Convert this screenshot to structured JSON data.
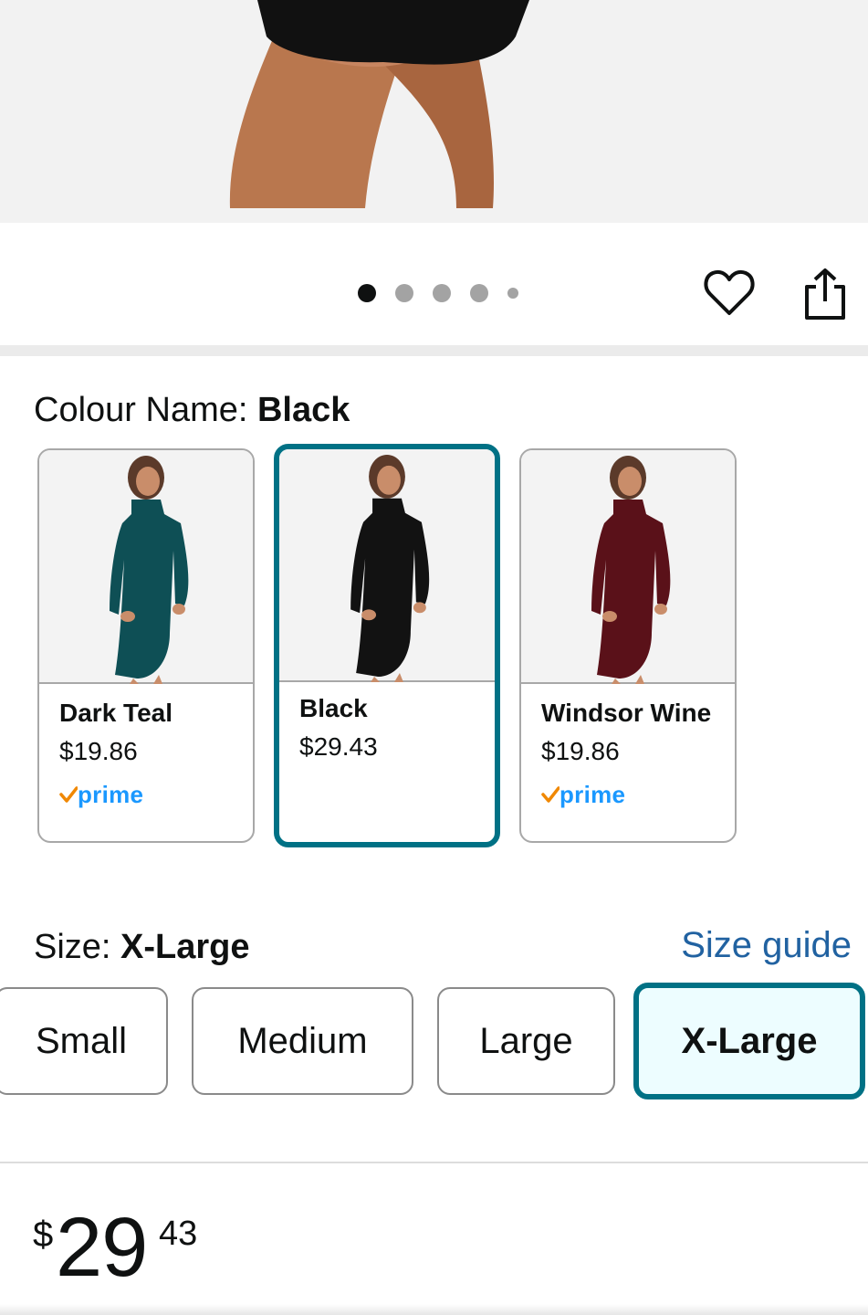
{
  "gallery": {
    "dot_count": 5,
    "active_index": 0
  },
  "colour": {
    "label": "Colour Name: ",
    "selected_value": "Black",
    "swatches": [
      {
        "name": "Dark Teal",
        "price": "$19.86",
        "prime": "prime",
        "color": "#0e4f55",
        "selected": false
      },
      {
        "name": "Black",
        "price": "$29.43",
        "prime": "",
        "color": "#121212",
        "selected": true
      },
      {
        "name": "Windsor Wine",
        "price": "$19.86",
        "prime": "prime",
        "color": "#5a1119",
        "selected": false
      }
    ]
  },
  "size": {
    "label": "Size: ",
    "selected_value": "X-Large",
    "guide_link": "Size guide",
    "options": [
      "Small",
      "Medium",
      "Large",
      "X-Large"
    ]
  },
  "price": {
    "symbol": "$",
    "whole": "29",
    "fraction": "43"
  },
  "colors": {
    "accent_selected": "#007185",
    "link": "#2162a1",
    "prime_blue": "#1a98ff",
    "prime_check": "#f08804"
  },
  "icons": {
    "wishlist": "heart-icon",
    "share": "share-icon"
  }
}
